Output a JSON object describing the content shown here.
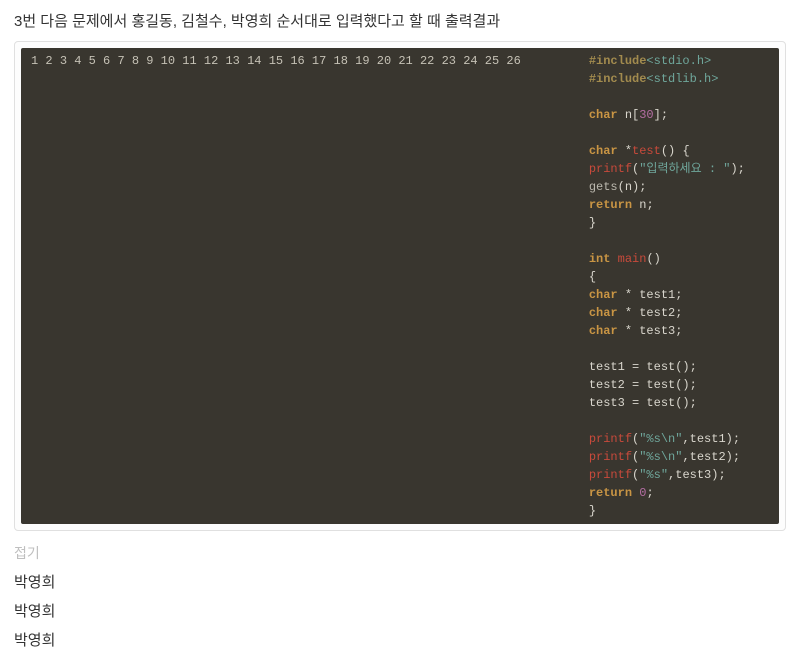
{
  "question": "3번 다음 문제에서 홍길동, 김철수, 박영희 순서대로 입력했다고 할 때 출력결과",
  "code": {
    "lines": [
      1,
      2,
      3,
      4,
      5,
      6,
      7,
      8,
      9,
      10,
      11,
      12,
      13,
      14,
      15,
      16,
      17,
      18,
      19,
      20,
      21,
      22,
      23,
      24,
      25,
      26
    ],
    "t": {
      "include": "#include",
      "stdio": "<stdio.h>",
      "stdlib": "<stdlib.h>",
      "char": "char",
      "int": "int",
      "return": "return",
      "n_decl": " n[",
      "n_decl_end": "];",
      "star": " *",
      "test": "test",
      "main": "main",
      "printf": "printf",
      "gets": "gets",
      "paren_open": "(",
      "paren_close": ")",
      "brace_open": "{",
      "brace_close": "}",
      "prompt_str": "\"입력하세요 : \"",
      "n_var": "n",
      "test1": " * test1;",
      "test2": " * test2;",
      "test3": " * test3;",
      "a1": "test1 = test();",
      "a2": "test2 = test();",
      "a3": "test3 = test();",
      "fmt_nl": "\"%s\\n\"",
      "fmt": "\"%s\"",
      "comma_t1": ",test1);",
      "comma_t2": ",test2);",
      "comma_t3": ",test3);",
      "semi": ";",
      "zero": "0",
      "thirty": "30",
      "space": " ",
      "paren_unit": "()"
    }
  },
  "fold": "접기",
  "output": [
    "박영희",
    "박영희",
    "박영희"
  ]
}
